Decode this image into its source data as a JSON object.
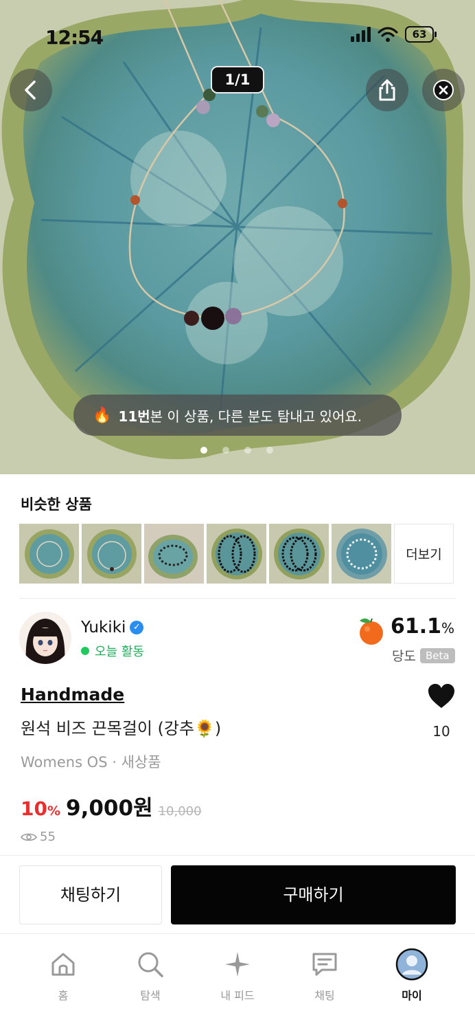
{
  "status_bar": {
    "time": "12:54",
    "battery": "63"
  },
  "viewer": {
    "counter": "1/1"
  },
  "toast": {
    "count": "11번",
    "text": " 본 이 상품, 다른 분도 탐내고 있어요."
  },
  "similar": {
    "title": "비슷한 상품",
    "more_label": "더보기"
  },
  "seller": {
    "name": "Yukiki",
    "activity": "오늘 활동",
    "score_value": "61.1",
    "score_unit": "%",
    "score_label": "당도",
    "score_badge": "Beta"
  },
  "product": {
    "brand": "Handmade",
    "title": "원석 비즈 끈목걸이 (강추🌻)",
    "meta": "Womens OS · 새상품",
    "discount_value": "10",
    "discount_unit": "%",
    "price": "9,000원",
    "original_price": "10,000",
    "views": "55",
    "likes": "10"
  },
  "actions": {
    "chat": "채팅하기",
    "buy": "구매하기"
  },
  "tabs": [
    {
      "label": "홈",
      "icon": "home-icon"
    },
    {
      "label": "탐색",
      "icon": "search-icon"
    },
    {
      "label": "내 피드",
      "icon": "sparkle-icon"
    },
    {
      "label": "채팅",
      "icon": "chat-icon"
    },
    {
      "label": "마이",
      "icon": "profile-icon"
    }
  ],
  "colors": {
    "accent_red": "#e5302f",
    "active_green": "#1fc85f",
    "verified_blue": "#2a8ef0"
  }
}
